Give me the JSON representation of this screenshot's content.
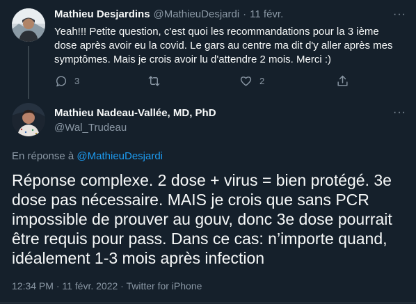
{
  "reply_tweet": {
    "author_name": "Mathieu Desjardins",
    "author_handle": "@MathieuDesjardi",
    "separator": "·",
    "date": "11 févr.",
    "text_lines": [
      "Yeah!!! Petite question, c'est quoi les recommandations pour la 3 ième",
      "dose après avoir eu la covid. Le gars au centre ma dit d'y aller après mes",
      "symptômes. Mais je crois avoir lu d'attendre 2 mois. Merci :)"
    ],
    "more_label": "···",
    "actions": {
      "reply_count": "3",
      "retweet_count": "",
      "like_count": "2"
    }
  },
  "main_tweet": {
    "author_name": "Mathieu Nadeau-Vallée, MD, PhD",
    "author_handle": "@Wal_Trudeau",
    "more_label": "···",
    "replying_prefix": "En réponse à",
    "replying_to": "@MathieuDesjardi",
    "text_lines": [
      "Réponse complexe. 2 dose + virus = bien protégé. 3e",
      "dose pas nécessaire. MAIS je crois que sans PCR",
      "impossible de prouver au gouv, donc 3e dose pourrait",
      "être requis pour pass. Dans ce cas: n’importe quand,",
      "idéalement 1-3 mois après infection"
    ],
    "timestamp": "12:34 PM · 11 févr. 2022 · Twitter for iPhone"
  },
  "colors": {
    "background": "#15202b",
    "text": "#f7f9f9",
    "muted": "#8b98a5",
    "link": "#1d9bf0",
    "divider": "#38444d"
  },
  "icons": {
    "reply": "reply-icon",
    "retweet": "retweet-icon",
    "like": "heart-icon",
    "share": "share-icon",
    "more": "more-icon"
  }
}
